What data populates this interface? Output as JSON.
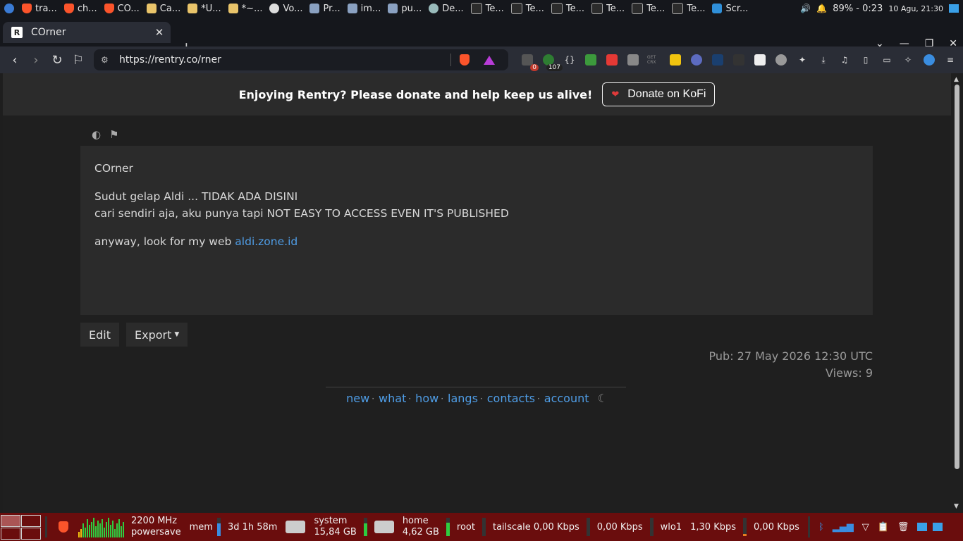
{
  "sysbar": {
    "tasks": [
      "tra...",
      "ch...",
      "CO...",
      "Ca...",
      "*U...",
      "*~...",
      "Vo...",
      "Pr...",
      "im...",
      "pu...",
      "De...",
      "Te...",
      "Te...",
      "Te...",
      "Te...",
      "Te...",
      "Te...",
      "Scr..."
    ],
    "battery": "89% - 0:23",
    "clock": "10 Agu, 21:30"
  },
  "tab": {
    "favicon": "R",
    "title": "COrner"
  },
  "toolbar": {
    "url": "https://rentry.co/rner",
    "ext_badges": {
      "ublock": "0",
      "counter": "107"
    },
    "ext_labels": {
      "getcrx": "GET CRX"
    }
  },
  "banner": {
    "message": "Enjoying Rentry? Please donate and help keep us alive!",
    "donate_label": "Donate on KoFi"
  },
  "content": {
    "title": "COrner",
    "line1": "Sudut gelap Aldi ... TIDAK ADA DISINI",
    "line2": "cari sendiri aja, aku punya tapi NOT EASY TO ACCESS EVEN IT'S PUBLISHED",
    "line3_prefix": "anyway, look for my web ",
    "line3_link": "aldi.zone.id"
  },
  "actions": {
    "edit": "Edit",
    "export": "Export"
  },
  "meta": {
    "pub": "Pub: 27 May 2026 12:30 UTC",
    "views": "Views: 9"
  },
  "footer": {
    "links": [
      "new",
      "what",
      "how",
      "langs",
      "contacts",
      "account"
    ]
  },
  "bottombar": {
    "cpu_freq": "2200 MHz",
    "governor": "powersave",
    "mem": "mem",
    "uptime": "3d 1h 58m",
    "system_label": "system",
    "system_size": "15,84 GB",
    "home_label": "home",
    "home_size": "4,62 GB",
    "root_label": "root",
    "tailscale": "tailscale 0,00 Kbps",
    "tailscale2": "0,00 Kbps",
    "wlo1": "wlo1",
    "wlo1_rx": "1,30 Kbps",
    "wlo1_tx": "0,00 Kbps"
  }
}
